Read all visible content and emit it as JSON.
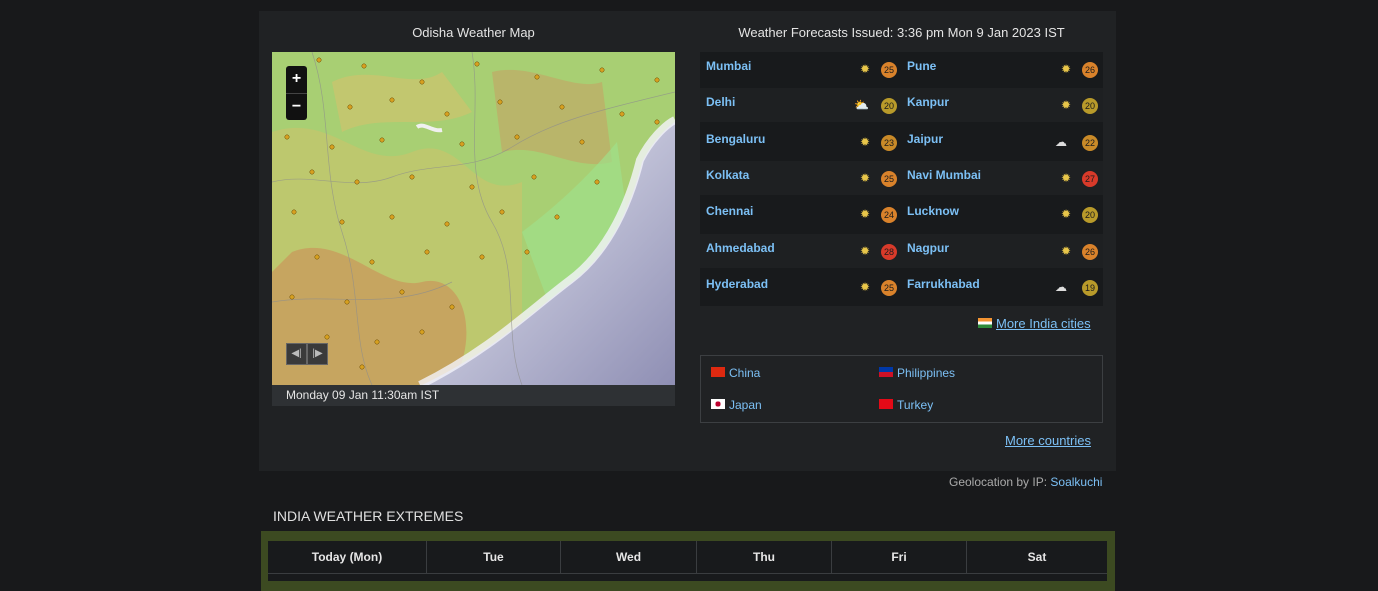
{
  "map": {
    "title": "Odisha Weather Map",
    "timestamp": "Monday 09 Jan 11:30am IST",
    "zoom_in": "+",
    "zoom_out": "−",
    "prev_icon": "skip-back-icon",
    "next_icon": "skip-forward-icon"
  },
  "forecasts": {
    "title": "Weather Forecasts Issued: 3:36 pm Mon 9 Jan 2023 IST",
    "rows": [
      [
        {
          "city": "Mumbai",
          "icon": "sunny-icon",
          "temp": "25",
          "color": "#d9822b"
        },
        {
          "city": "Pune",
          "icon": "sunny-icon",
          "temp": "26",
          "color": "#d9822b"
        }
      ],
      [
        {
          "city": "Delhi",
          "icon": "partly-cloudy-icon",
          "temp": "20",
          "color": "#b89a2a"
        },
        {
          "city": "Kanpur",
          "icon": "sunny-icon",
          "temp": "20",
          "color": "#b89a2a"
        }
      ],
      [
        {
          "city": "Bengaluru",
          "icon": "sunny-icon",
          "temp": "23",
          "color": "#c98a28"
        },
        {
          "city": "Jaipur",
          "icon": "cloudy-icon",
          "temp": "22",
          "color": "#c98a28"
        }
      ],
      [
        {
          "city": "Kolkata",
          "icon": "sunny-icon",
          "temp": "25",
          "color": "#d9822b"
        },
        {
          "city": "Navi Mumbai",
          "icon": "sunny-icon",
          "temp": "27",
          "color": "#d83a2a"
        }
      ],
      [
        {
          "city": "Chennai",
          "icon": "sunny-icon",
          "temp": "24",
          "color": "#d9822b"
        },
        {
          "city": "Lucknow",
          "icon": "sunny-icon",
          "temp": "20",
          "color": "#b89a2a"
        }
      ],
      [
        {
          "city": "Ahmedabad",
          "icon": "sunny-icon",
          "temp": "28",
          "color": "#d83a2a"
        },
        {
          "city": "Nagpur",
          "icon": "sunny-icon",
          "temp": "26",
          "color": "#d9822b"
        }
      ],
      [
        {
          "city": "Hyderabad",
          "icon": "sunny-icon",
          "temp": "25",
          "color": "#d9822b"
        },
        {
          "city": "Farrukhabad",
          "icon": "cloudy-icon",
          "temp": "19",
          "color": "#b89a2a"
        }
      ]
    ],
    "more_india": "More India cities"
  },
  "countries": {
    "items": [
      "China",
      "Philippines",
      "Japan",
      "Turkey"
    ],
    "more": "More countries"
  },
  "geo": {
    "label": "Geolocation by IP:",
    "place": "Soalkuchi"
  },
  "extremes": {
    "title": "INDIA WEATHER EXTREMES",
    "days": [
      "Today (Mon)",
      "Tue",
      "Wed",
      "Thu",
      "Fri",
      "Sat"
    ]
  }
}
